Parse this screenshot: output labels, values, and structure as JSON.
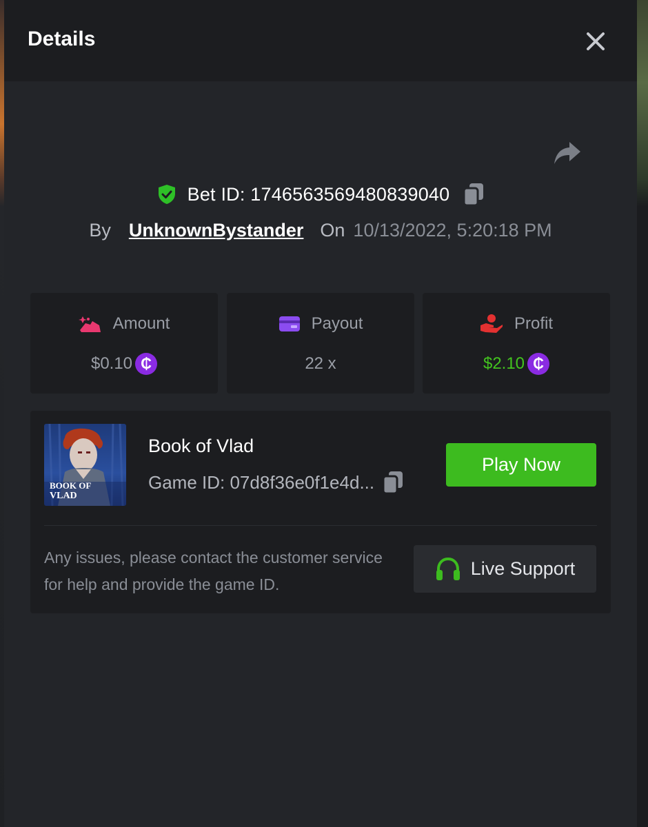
{
  "modal": {
    "title": "Details"
  },
  "bet": {
    "id_text": "Bet ID: 1746563569480839040",
    "by_label": "By",
    "username": "UnknownBystander",
    "on_label": "On",
    "datetime": "10/13/2022, 5:20:18 PM"
  },
  "stats": {
    "amount": {
      "label": "Amount",
      "value": "$0.10"
    },
    "payout": {
      "label": "Payout",
      "value": "22 x"
    },
    "profit": {
      "label": "Profit",
      "value": "$2.10"
    }
  },
  "coin_symbol": "₵",
  "game": {
    "name": "Book of Vlad",
    "id_text": "Game ID: 07d8f36e0f1e4d...",
    "thumb_line1": "BOOK OF",
    "thumb_line2": "VLAD",
    "play_label": "Play Now"
  },
  "help": {
    "text": "Any issues, please contact the customer service for help and provide the game ID.",
    "support_label": "Live Support"
  },
  "colors": {
    "accent_green": "#3dbb1f",
    "profit_green": "#43c41f",
    "amount_pink": "#e8386f",
    "payout_purple": "#8b4cf0",
    "profit_red": "#e33131",
    "coin_purple": "#8a2be2"
  },
  "icons": {
    "close": "close-icon",
    "share": "share-icon",
    "verified": "shield-check-icon",
    "copy": "copy-icon",
    "amount": "money-hand-icon",
    "payout": "wallet-card-icon",
    "profit": "hand-profit-icon",
    "coin": "coin-icon",
    "support": "headset-icon"
  }
}
